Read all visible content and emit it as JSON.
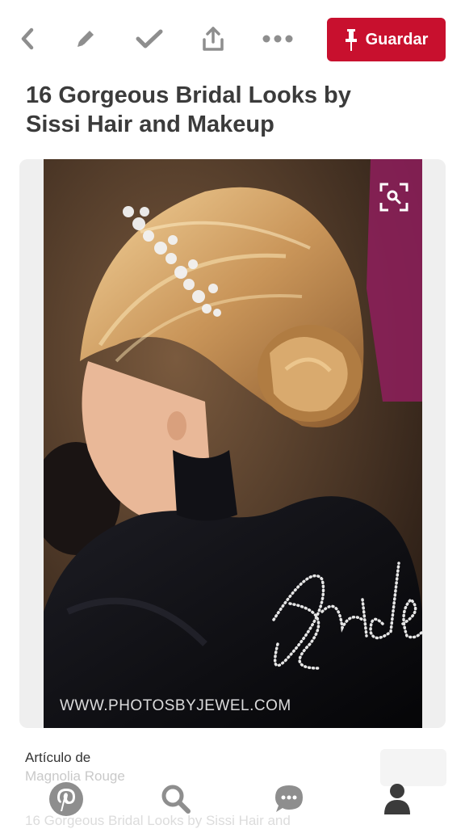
{
  "toolbar": {
    "back_icon": "chevron-left-icon",
    "edit_icon": "pencil-icon",
    "done_icon": "check-icon",
    "share_icon": "share-icon",
    "more_icon": "more-dots-icon",
    "save_label": "Guardar",
    "save_icon": "pushpin-icon"
  },
  "pin": {
    "title": "16 Gorgeous Bridal Looks by Sissi Hair and Makeup",
    "image_watermark": "WWW.PHOTOSBYJEWEL.COM",
    "lens_icon": "visual-search-icon"
  },
  "source": {
    "label": "Artículo de",
    "name": "Magnolia Rouge",
    "description": "16 Gorgeous Bridal Looks by Sissi Hair and"
  },
  "tabbar": {
    "home_icon": "pinterest-icon",
    "search_icon": "search-icon",
    "messages_icon": "chat-bubble-icon",
    "profile_icon": "profile-icon"
  },
  "colors": {
    "brand_red": "#c8102e",
    "icon_gray": "#8e8e8e",
    "title_text": "#3b3b3b",
    "card_bg": "#efefef"
  }
}
